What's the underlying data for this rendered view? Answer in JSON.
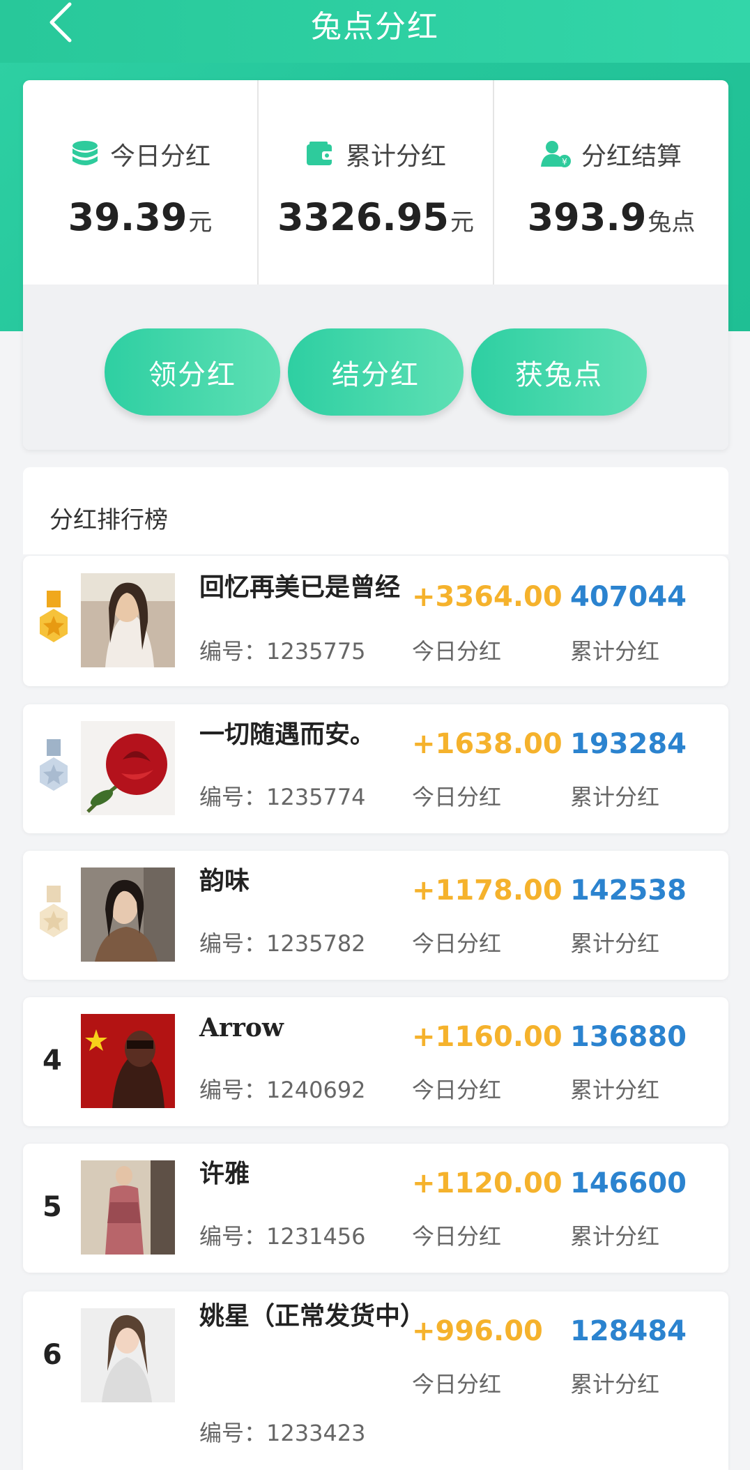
{
  "header": {
    "title": "兔点分红",
    "back_icon": "chevron-left-icon"
  },
  "stats": [
    {
      "icon": "coins-stack-icon",
      "label": "今日分红",
      "value": "39.39",
      "unit": "元"
    },
    {
      "icon": "wallet-icon",
      "label": "累计分红",
      "value": "3326.95",
      "unit": "元"
    },
    {
      "icon": "user-yen-icon",
      "label": "分红结算",
      "value": "393.9",
      "unit": "兔点"
    }
  ],
  "actions": [
    "领分红",
    "结分红",
    "获兔点"
  ],
  "ranking": {
    "title": "分红排行榜",
    "id_prefix": "编号：",
    "today_label": "今日分红",
    "total_label": "累计分红",
    "items": [
      {
        "rank": "1",
        "badge": "gold-medal-icon",
        "name": "回忆再美已是曾经",
        "id": "1235775",
        "today": "+3364.00",
        "total": "407044"
      },
      {
        "rank": "2",
        "badge": "silver-medal-icon",
        "name": "一切随遇而安。",
        "id": "1235774",
        "today": "+1638.00",
        "total": "193284"
      },
      {
        "rank": "3",
        "badge": "bronze-medal-icon",
        "name": "韵味",
        "id": "1235782",
        "today": "+1178.00",
        "total": "142538"
      },
      {
        "rank": "4",
        "name": "Arrow",
        "id": "1240692",
        "today": "+1160.00",
        "total": "136880"
      },
      {
        "rank": "5",
        "name": "许雅",
        "id": "1231456",
        "today": "+1120.00",
        "total": "146600"
      },
      {
        "rank": "6",
        "name": "姚星（正常发货中）",
        "id": "1233423",
        "today": "+996.00",
        "total": "128484"
      }
    ]
  },
  "colors": {
    "accent": "#2ecfa2",
    "today_value": "#f5b22c",
    "total_value": "#2b83cf"
  }
}
